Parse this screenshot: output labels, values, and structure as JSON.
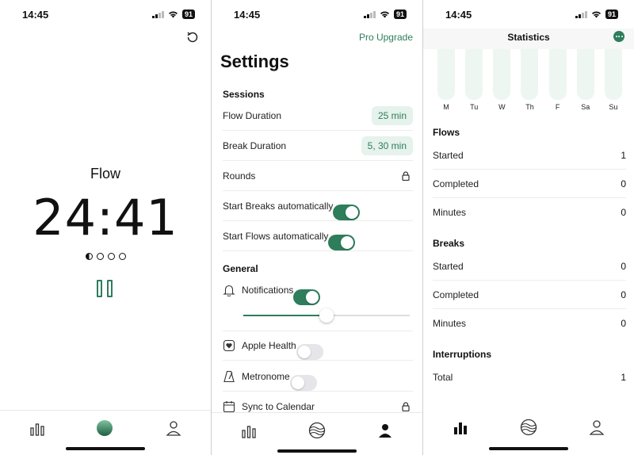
{
  "status": {
    "time": "14:45",
    "battery": "91"
  },
  "timer_screen": {
    "mode": "Flow",
    "time_remaining": "24:41",
    "rounds_total": 4,
    "rounds_progress": 0.5
  },
  "settings_screen": {
    "pro_upgrade": "Pro Upgrade",
    "title": "Settings",
    "sessions_label": "Sessions",
    "flow_duration_label": "Flow Duration",
    "flow_duration_value": "25 min",
    "break_duration_label": "Break Duration",
    "break_duration_value": "5, 30 min",
    "rounds_label": "Rounds",
    "start_breaks_label": "Start Breaks automatically",
    "start_breaks_on": true,
    "start_flows_label": "Start Flows automatically",
    "start_flows_on": true,
    "general_label": "General",
    "notifications_label": "Notifications",
    "notifications_on": true,
    "volume_level": 0.5,
    "apple_health_label": "Apple Health",
    "apple_health_on": false,
    "metronome_label": "Metronome",
    "metronome_on": false,
    "sync_calendar_label": "Sync to Calendar"
  },
  "statistics_screen": {
    "title": "Statistics",
    "days": [
      "M",
      "Tu",
      "W",
      "Th",
      "F",
      "Sa",
      "Su"
    ],
    "flows_label": "Flows",
    "flows": [
      {
        "label": "Started",
        "value": "1"
      },
      {
        "label": "Completed",
        "value": "0"
      },
      {
        "label": "Minutes",
        "value": "0"
      }
    ],
    "breaks_label": "Breaks",
    "breaks": [
      {
        "label": "Started",
        "value": "0"
      },
      {
        "label": "Completed",
        "value": "0"
      },
      {
        "label": "Minutes",
        "value": "0"
      }
    ],
    "interruptions_label": "Interruptions",
    "interruptions": [
      {
        "label": "Total",
        "value": "1"
      }
    ]
  },
  "colors": {
    "accent": "#2e7d5b",
    "accent_light": "#e6f2ec",
    "bar_bg": "#eef6f1"
  },
  "icons": {
    "refresh": "refresh-icon",
    "pause": "pause-icon",
    "stats_tab": "bar-chart-icon",
    "flow_tab": "globe-icon",
    "profile_tab": "person-icon",
    "lock": "lock-icon",
    "bell": "bell-icon",
    "health": "heart-icon",
    "metronome": "metronome-icon",
    "calendar": "calendar-icon",
    "more": "more-icon"
  }
}
